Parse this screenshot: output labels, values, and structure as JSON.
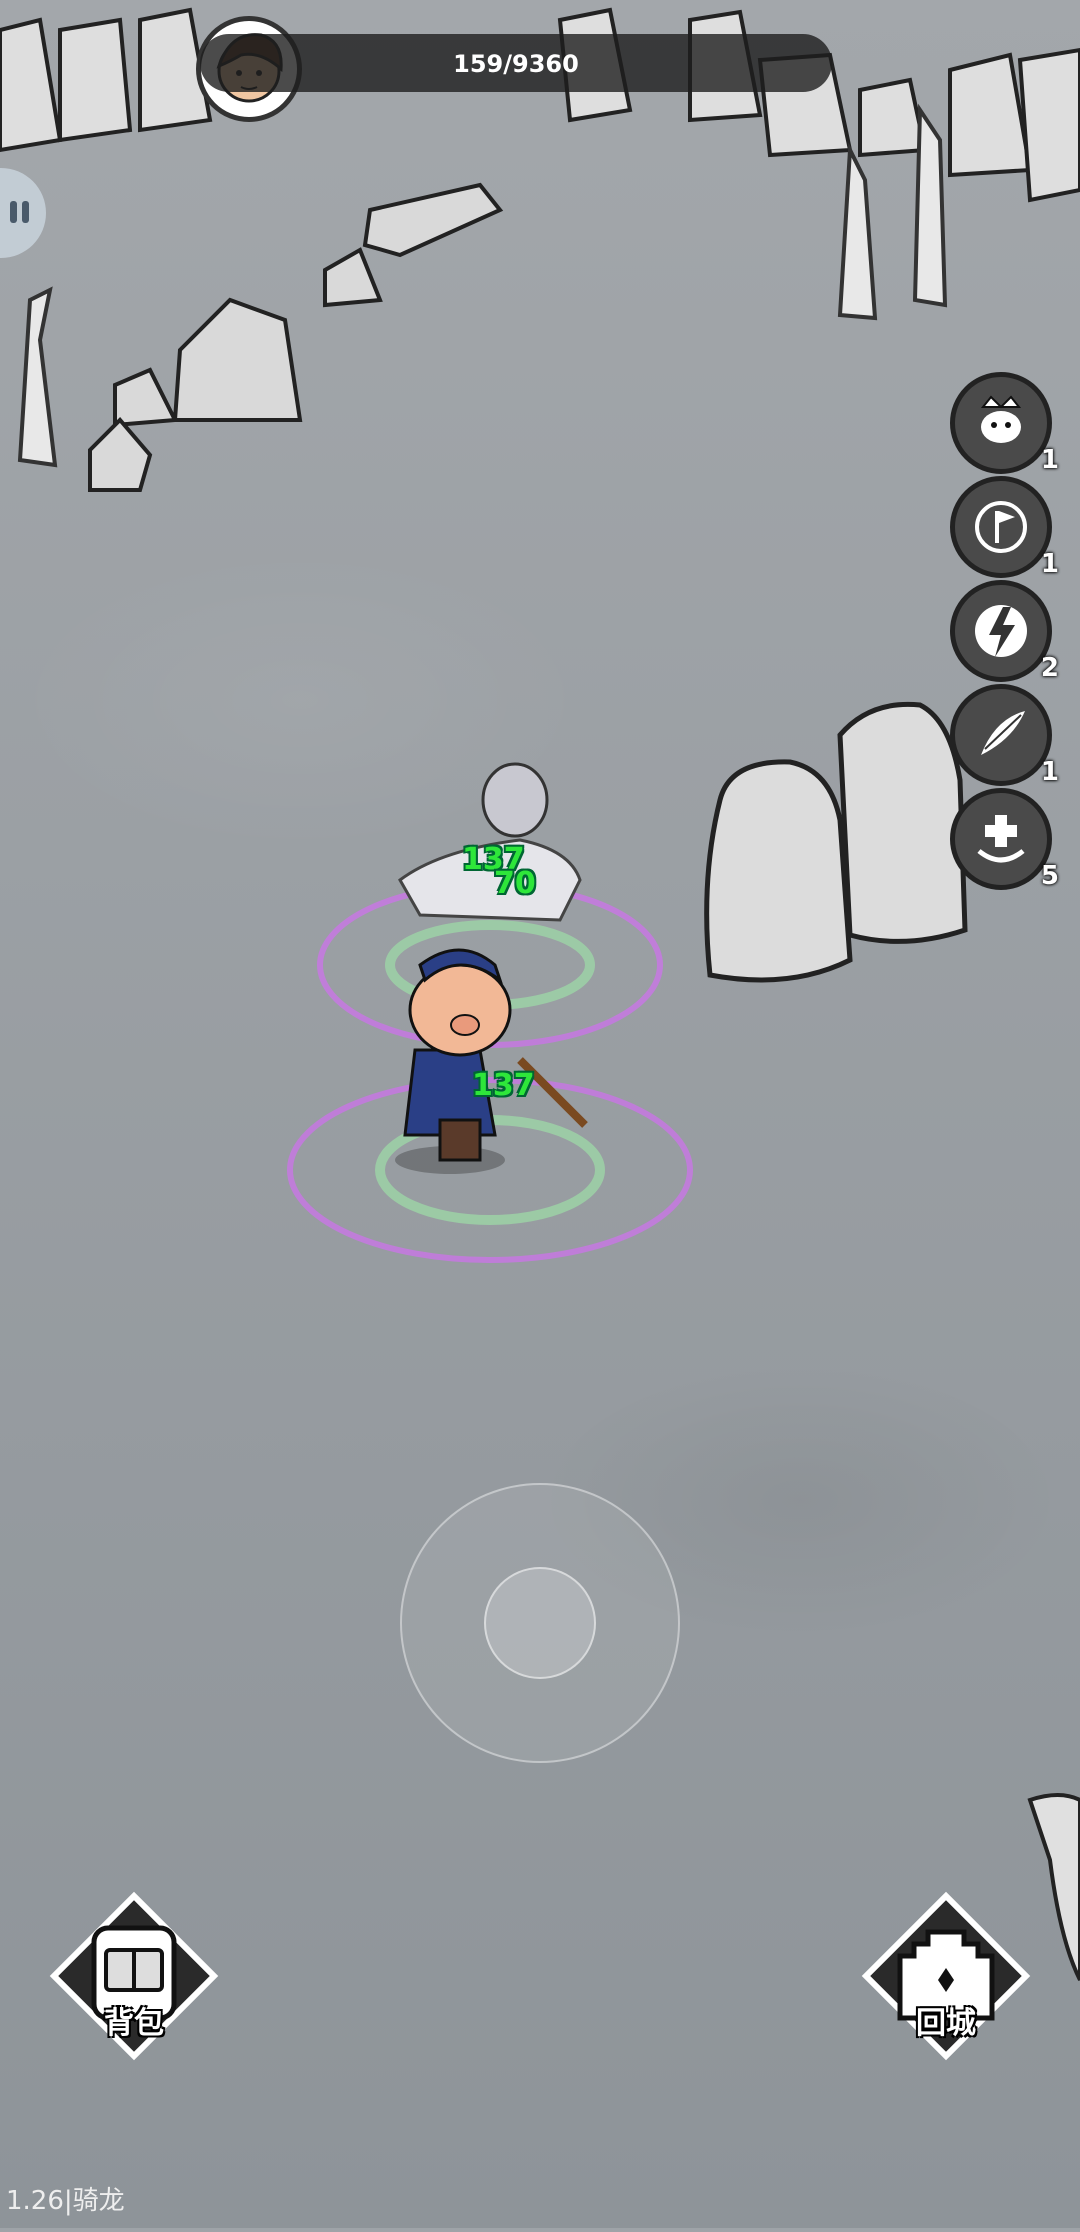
{
  "hud": {
    "hp_text": "159/9360"
  },
  "skills": [
    {
      "icon": "crown-cat-icon",
      "count": "1"
    },
    {
      "icon": "flag-target-icon",
      "count": "1"
    },
    {
      "icon": "lightning-icon",
      "count": "2"
    },
    {
      "icon": "feather-blade-icon",
      "count": "1"
    },
    {
      "icon": "healing-plus-icon",
      "count": "5"
    }
  ],
  "damage_numbers": [
    "137",
    "70",
    "137"
  ],
  "buttons": {
    "backpack": "背包",
    "return_city": "回城"
  },
  "version": "1.26|骑龙",
  "colors": {
    "damage": "#2ee63a",
    "ground": "#9ea3a8",
    "aura": "#d070f0"
  }
}
